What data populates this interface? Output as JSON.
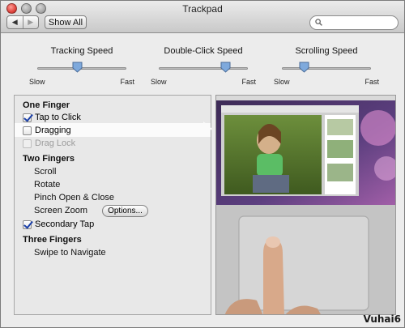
{
  "window": {
    "title": "Trackpad"
  },
  "toolbar": {
    "back_icon": "back-arrow-icon",
    "forward_icon": "forward-arrow-icon",
    "show_all_label": "Show All",
    "search_placeholder": ""
  },
  "sliders": [
    {
      "label": "Tracking Speed",
      "min_label": "Slow",
      "max_label": "Fast",
      "value": 0.45
    },
    {
      "label": "Double-Click Speed",
      "min_label": "Slow",
      "max_label": "Fast",
      "value": 0.75
    },
    {
      "label": "Scrolling Speed",
      "min_label": "Slow",
      "max_label": "Fast",
      "value": 0.25
    }
  ],
  "options": {
    "one_finger": {
      "heading": "One Finger",
      "tap_to_click": {
        "label": "Tap to Click",
        "checked": true
      },
      "dragging": {
        "label": "Dragging",
        "checked": false
      },
      "drag_lock": {
        "label": "Drag Lock",
        "checked": false,
        "enabled": false
      }
    },
    "two_fingers": {
      "heading": "Two Fingers",
      "scroll": "Scroll",
      "rotate": "Rotate",
      "pinch": "Pinch Open & Close",
      "screen_zoom": "Screen Zoom",
      "options_button": "Options...",
      "secondary_tap": {
        "label": "Secondary Tap",
        "checked": true
      }
    },
    "three_fingers": {
      "heading": "Three Fingers",
      "swipe": "Swipe to Navigate"
    }
  },
  "watermark": "Vuhai6",
  "colors": {
    "window_bg": "#ececec",
    "checkbox_check": "#1a3fa8",
    "selected_row": "#fbfbfb"
  }
}
